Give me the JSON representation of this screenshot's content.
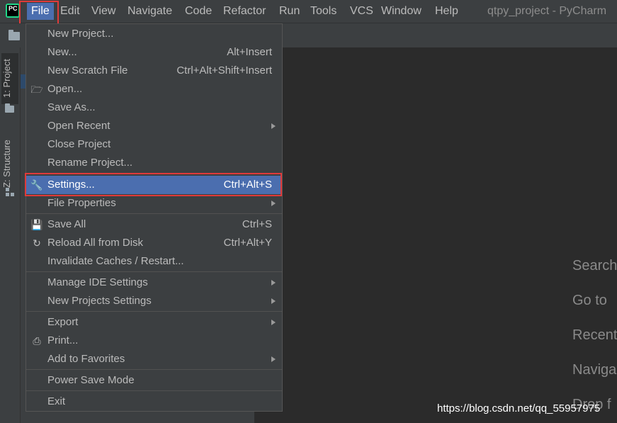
{
  "menubar": {
    "items": [
      "File",
      "Edit",
      "View",
      "Navigate",
      "Code",
      "Refactor",
      "Run",
      "Tools",
      "VCS",
      "Window",
      "Help"
    ],
    "window_title": "qtpy_project - PyCharm"
  },
  "side_tabs": {
    "project": "1: Project",
    "structure": "Z: Structure"
  },
  "file_menu": {
    "items": [
      {
        "label": "New Project..."
      },
      {
        "label": "New...",
        "shortcut": "Alt+Insert"
      },
      {
        "label": "New Scratch File",
        "shortcut": "Ctrl+Alt+Shift+Insert"
      },
      {
        "label": "Open...",
        "icon": "open-folder-icon"
      },
      {
        "label": "Save As..."
      },
      {
        "label": "Open Recent",
        "submenu": true
      },
      {
        "label": "Close Project"
      },
      {
        "label": "Rename Project..."
      },
      {
        "label": "Settings...",
        "shortcut": "Ctrl+Alt+S",
        "icon": "wrench-icon",
        "selected": true
      },
      {
        "label": "File Properties",
        "submenu": true
      },
      {
        "label": "Save All",
        "shortcut": "Ctrl+S",
        "icon": "save-icon"
      },
      {
        "label": "Reload All from Disk",
        "shortcut": "Ctrl+Alt+Y",
        "icon": "reload-icon"
      },
      {
        "label": "Invalidate Caches / Restart..."
      },
      {
        "label": "Manage IDE Settings",
        "submenu": true
      },
      {
        "label": "New Projects Settings",
        "submenu": true
      },
      {
        "label": "Export",
        "submenu": true
      },
      {
        "label": "Print...",
        "icon": "printer-icon"
      },
      {
        "label": "Add to Favorites",
        "submenu": true
      },
      {
        "label": "Power Save Mode"
      },
      {
        "label": "Exit"
      }
    ]
  },
  "editor_hints": [
    "Search",
    "Go to",
    "Recent",
    "Naviga",
    "Drop f"
  ],
  "watermark": "https://blog.csdn.net/qq_55957975",
  "colors": {
    "selection": "#4b6eaf",
    "highlight_box": "#e03a3a",
    "background": "#2b2b2b",
    "panel": "#3c3f41"
  }
}
